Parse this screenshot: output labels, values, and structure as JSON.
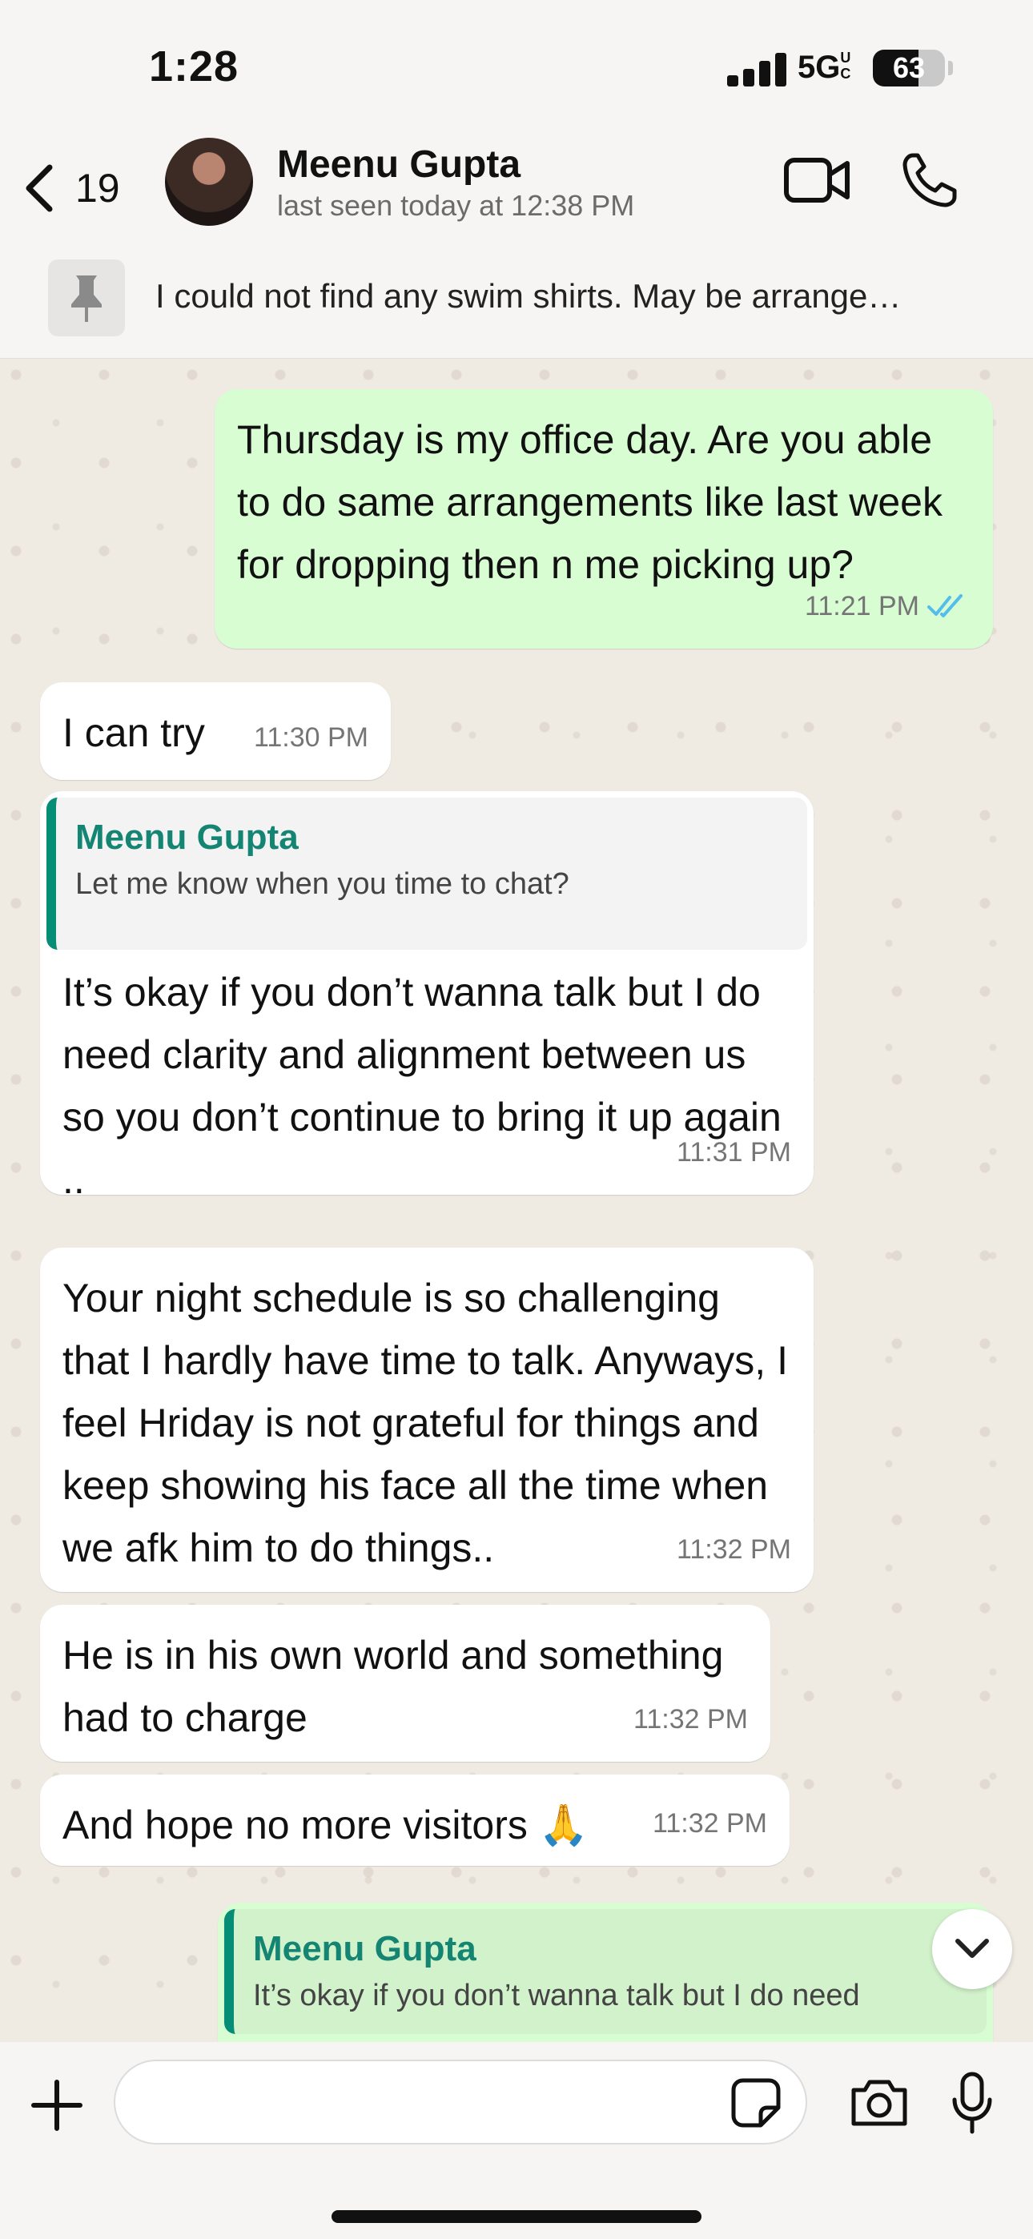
{
  "status_bar": {
    "time": "1:28",
    "network": "5G",
    "network_suffix": "UC",
    "battery": "63",
    "battery_level": 0.63
  },
  "header": {
    "back_count": "19",
    "contact_name": "Meenu Gupta",
    "last_seen": "last seen today at 12:38 PM",
    "icons": {
      "back": "chevron-left-icon",
      "video": "video-camera-icon",
      "call": "phone-icon"
    }
  },
  "pinned": {
    "icon": "pin-icon",
    "text": "I could not find any swim shirts. May be arrange…"
  },
  "messages": [
    {
      "direction": "out",
      "text": "Thursday is my office day. Are you able to do same arrangements like last week for dropping then n me picking up?",
      "time": "11:21 PM",
      "read": true
    },
    {
      "direction": "in",
      "text": "I can try",
      "time": "11:30 PM"
    },
    {
      "direction": "in",
      "quote_author": "Meenu Gupta",
      "quote_text": "Let me know when you time to chat?",
      "text": "It’s okay if you don’t wanna talk but I do need clarity and alignment between us so you don’t continue to bring it up again ..",
      "time": "11:31 PM"
    },
    {
      "direction": "in",
      "text": "Your night schedule is so challenging that I hardly have time to talk. Anyways, I feel Hriday is not grateful for things and keep showing his face all the time when we afk him to do things..",
      "time": "11:32 PM"
    },
    {
      "direction": "in",
      "text": "He is in his own world and something had to charge",
      "time": "11:32 PM"
    },
    {
      "direction": "in",
      "text": "And hope no more visitors 🙏",
      "time": "11:32 PM"
    },
    {
      "direction": "out",
      "quote_author": "Meenu Gupta",
      "quote_text": "It’s okay if you don’t wanna talk but I do need"
    }
  ],
  "input": {
    "placeholder": "",
    "value": "",
    "icons": {
      "plus": "plus-icon",
      "sticker": "sticker-icon",
      "camera": "camera-icon",
      "mic": "microphone-icon",
      "scroll_down": "chevron-down-icon"
    }
  },
  "colors": {
    "outgoing_bubble": "#d9fdd3",
    "incoming_bubble": "#ffffff",
    "quote_accent": "#068d76",
    "read_ticks": "#53bdeb",
    "chat_background": "#efeae2"
  }
}
